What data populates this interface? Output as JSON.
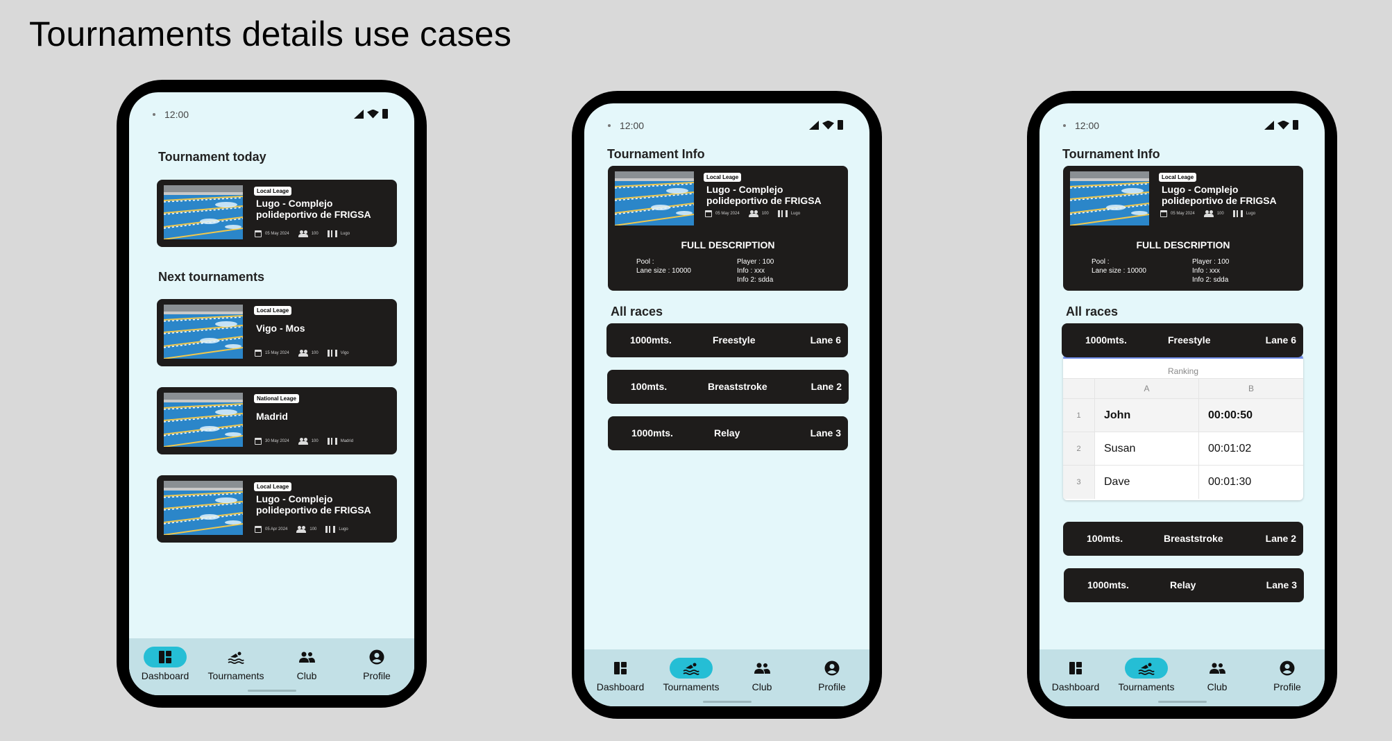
{
  "page_title": "Tournaments details use cases",
  "status_time": "12:00",
  "nav": [
    "Dashboard",
    "Tournaments",
    "Club",
    "Profile"
  ],
  "phone1": {
    "today_title": "Tournament today",
    "next_title": "Next tournaments",
    "today_card": {
      "badge": "Local Leage",
      "name": "Lugo - Complejo polideportivo de FRIGSA",
      "date": "05 May 2024",
      "players": "100",
      "city": "Lugo"
    },
    "next_cards": [
      {
        "badge": "Local Leage",
        "name": "Vigo - Mos",
        "date": "15 May 2024",
        "players": "100",
        "city": "Vigo"
      },
      {
        "badge": "National Leage",
        "name": "Madrid",
        "date": "30 May 2024",
        "players": "100",
        "city": "Madrid"
      },
      {
        "badge": "Local Leage",
        "name": "Lugo - Complejo polideportivo de FRIGSA",
        "date": "05 Apr 2024",
        "players": "100",
        "city": "Lugo"
      }
    ]
  },
  "info": {
    "title": "Tournament Info",
    "badge": "Local Leage",
    "name": "Lugo - Complejo polideportivo de FRIGSA",
    "date": "05 May 2024",
    "players": "100",
    "city": "Lugo",
    "desc_title": "FULL DESCRIPTION",
    "left_lines": [
      "Pool :",
      "Lane size : 10000"
    ],
    "right_lines": [
      "Player : 100",
      "Info : xxx",
      "Info 2: sdda"
    ],
    "races_title": "All races",
    "races": [
      {
        "distance": "1000mts.",
        "style": "Freestyle",
        "lane": "Lane 6"
      },
      {
        "distance": "100mts.",
        "style": "Breaststroke",
        "lane": "Lane 2"
      },
      {
        "distance": "1000mts.",
        "style": "Relay",
        "lane": "Lane 3"
      }
    ]
  },
  "ranking": {
    "title": "Ranking",
    "columns": [
      "A",
      "B"
    ],
    "rows": [
      {
        "n": "1",
        "name": "John",
        "time": "00:00:50"
      },
      {
        "n": "2",
        "name": "Susan",
        "time": "00:01:02"
      },
      {
        "n": "3",
        "name": "Dave",
        "time": "00:01:30"
      }
    ]
  },
  "colors": {
    "screen_bg": "#e4f7fa",
    "card_bg": "#1e1c1b",
    "nav_bg": "#c2e0e6",
    "active_pill": "#25bed5",
    "ranking_accent": "#6f8ce8"
  }
}
